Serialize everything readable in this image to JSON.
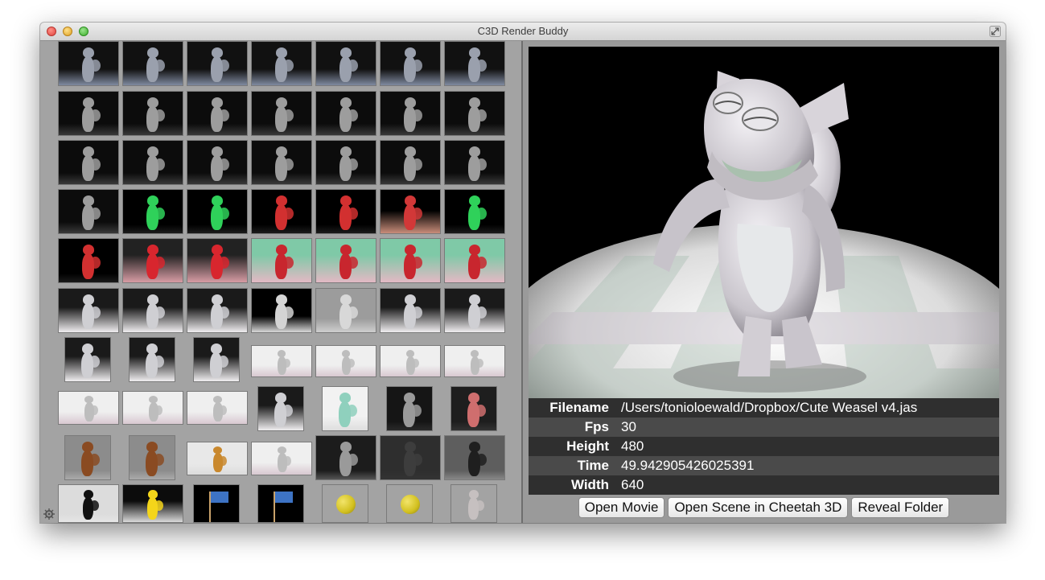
{
  "window": {
    "title": "C3D Render Buddy",
    "icons": [
      "close-button",
      "minimize-button",
      "zoom-button",
      "fullscreen-icon"
    ]
  },
  "thumbnails": {
    "count": 70,
    "rows": [
      [
        "floor-grey",
        "floor-grey",
        "floor-grey",
        "floor-grey",
        "floor-grey",
        "floor-grey",
        "floor-grey"
      ],
      [
        "dark-grey",
        "dark-grey",
        "dark-grey",
        "dark-grey",
        "dark-grey",
        "dark-grey",
        "dark-grey"
      ],
      [
        "dark-grey",
        "dark-grey",
        "dark-grey",
        "dark-grey",
        "dark-grey",
        "dark-grey",
        "dark-grey"
      ],
      [
        "dark-grey",
        "green",
        "green",
        "red",
        "red",
        "red-floor",
        "green"
      ],
      [
        "red",
        "red-pink",
        "red-pink",
        "red-checker",
        "red-checker",
        "red-checker",
        "red-checker"
      ],
      [
        "white-floor",
        "white-floor",
        "white-floor",
        "black-spot",
        "grey-spot",
        "white-floor",
        "white-floor"
      ],
      [
        "white-floor",
        "white-floor",
        "white-floor",
        "white-wide",
        "white-wide",
        "white-wide",
        "white-wide"
      ],
      [
        "white-wide",
        "white-wide",
        "white-wide",
        "white-floor",
        "teal-figure",
        "elephant-dark",
        "elephant-red"
      ],
      [
        "elephant-brown",
        "elephant-brown",
        "bear-color",
        "white-wide",
        "ship-grey",
        "dark-flat",
        "ship-dark"
      ],
      [
        "ship-black",
        "car-yellow",
        "flag-un",
        "flag-un",
        "ball-yellow",
        "ball-yellow",
        "cloth-grey"
      ]
    ]
  },
  "preview": {
    "subject": "cute-weasel-render"
  },
  "info": {
    "rows": [
      {
        "key": "Filename",
        "value": "/Users/tonioloewald/Dropbox/Cute Weasel v4.jas"
      },
      {
        "key": "Fps",
        "value": "30"
      },
      {
        "key": "Height",
        "value": "480"
      },
      {
        "key": "Time",
        "value": "49.942905426025391"
      },
      {
        "key": "Width",
        "value": "640"
      }
    ]
  },
  "buttons": {
    "open_movie": "Open Movie",
    "open_scene": "Open Scene in Cheetah 3D",
    "reveal_folder": "Reveal Folder"
  }
}
